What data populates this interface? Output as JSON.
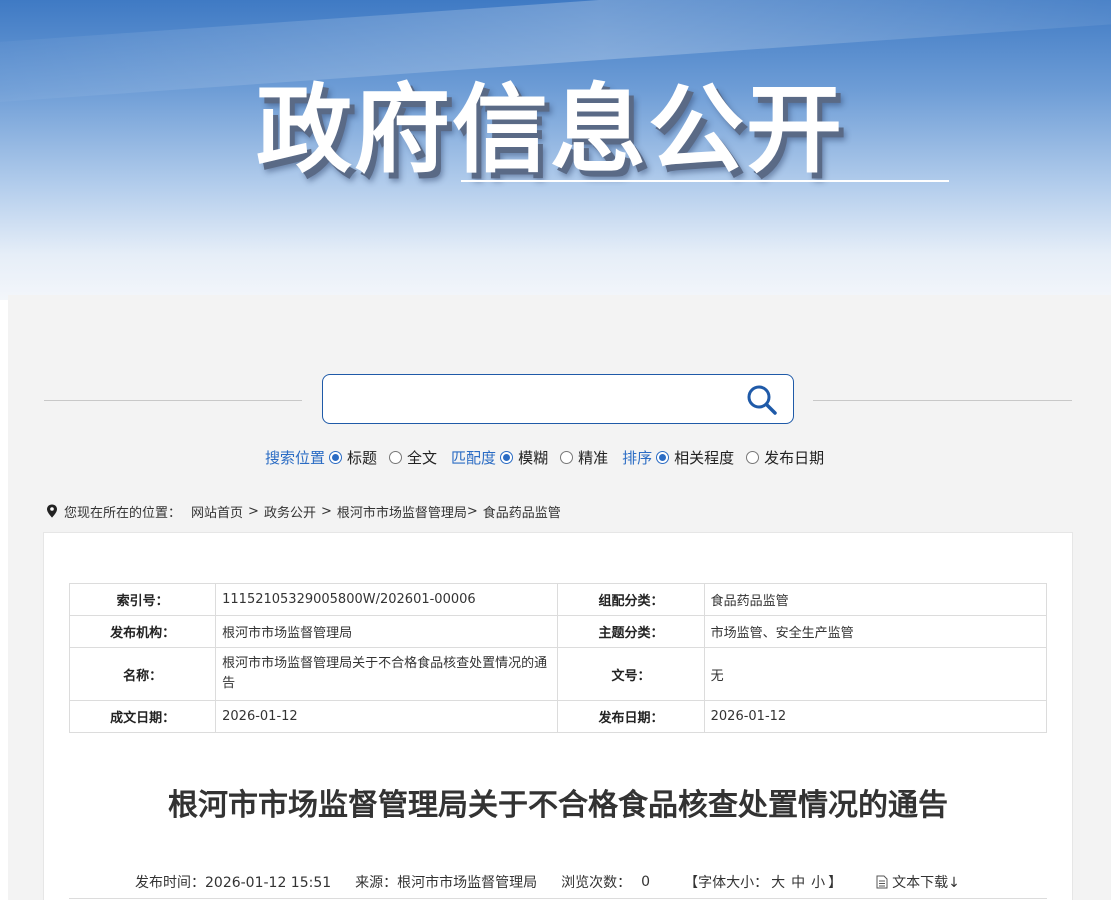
{
  "banner": {
    "title": "政府信息公开"
  },
  "search": {
    "placeholder": "",
    "options": {
      "position_label": "搜索位置",
      "position_choices": [
        "标题",
        "全文"
      ],
      "match_label": "匹配度",
      "match_choices": [
        "模糊",
        "精准"
      ],
      "sort_label": "排序",
      "sort_choices": [
        "相关程度",
        "发布日期"
      ]
    }
  },
  "breadcrumb": {
    "prefix": "您现在所在的位置：",
    "items": [
      "网站首页",
      "政务公开",
      "根河市市场监督管理局",
      "食品药品监管"
    ]
  },
  "meta": {
    "index_no_label": "索引号：",
    "index_no": "11152105329005800W/202601-00006",
    "category_label": "组配分类：",
    "category": "食品药品监管",
    "publisher_label": "发布机构：",
    "publisher": "根河市市场监督管理局",
    "topic_label": "主题分类：",
    "topic": "市场监管、安全生产监管",
    "name_label": "名称：",
    "name": "根河市市场监督管理局关于不合格食品核查处置情况的通告",
    "doc_no_label": "文号：",
    "doc_no": "无",
    "created_label": "成文日期：",
    "created": "2026-01-12",
    "published_label": "发布日期：",
    "published": "2026-01-12"
  },
  "doc": {
    "title": "根河市市场监督管理局关于不合格食品核查处置情况的通告",
    "publish_time": "发布时间：2026-01-12 15:51",
    "source": "来源：根河市市场监督管理局",
    "views_label": "浏览次数：",
    "views": "0",
    "font_size_prefix": "【字体大小：",
    "font_large": "大",
    "font_medium": "中",
    "font_small": "小",
    "font_size_suffix": "】",
    "download_label": "文本下载↓"
  },
  "colors": {
    "accent": "#2b6cc4",
    "search_border": "#1f5aa8"
  }
}
